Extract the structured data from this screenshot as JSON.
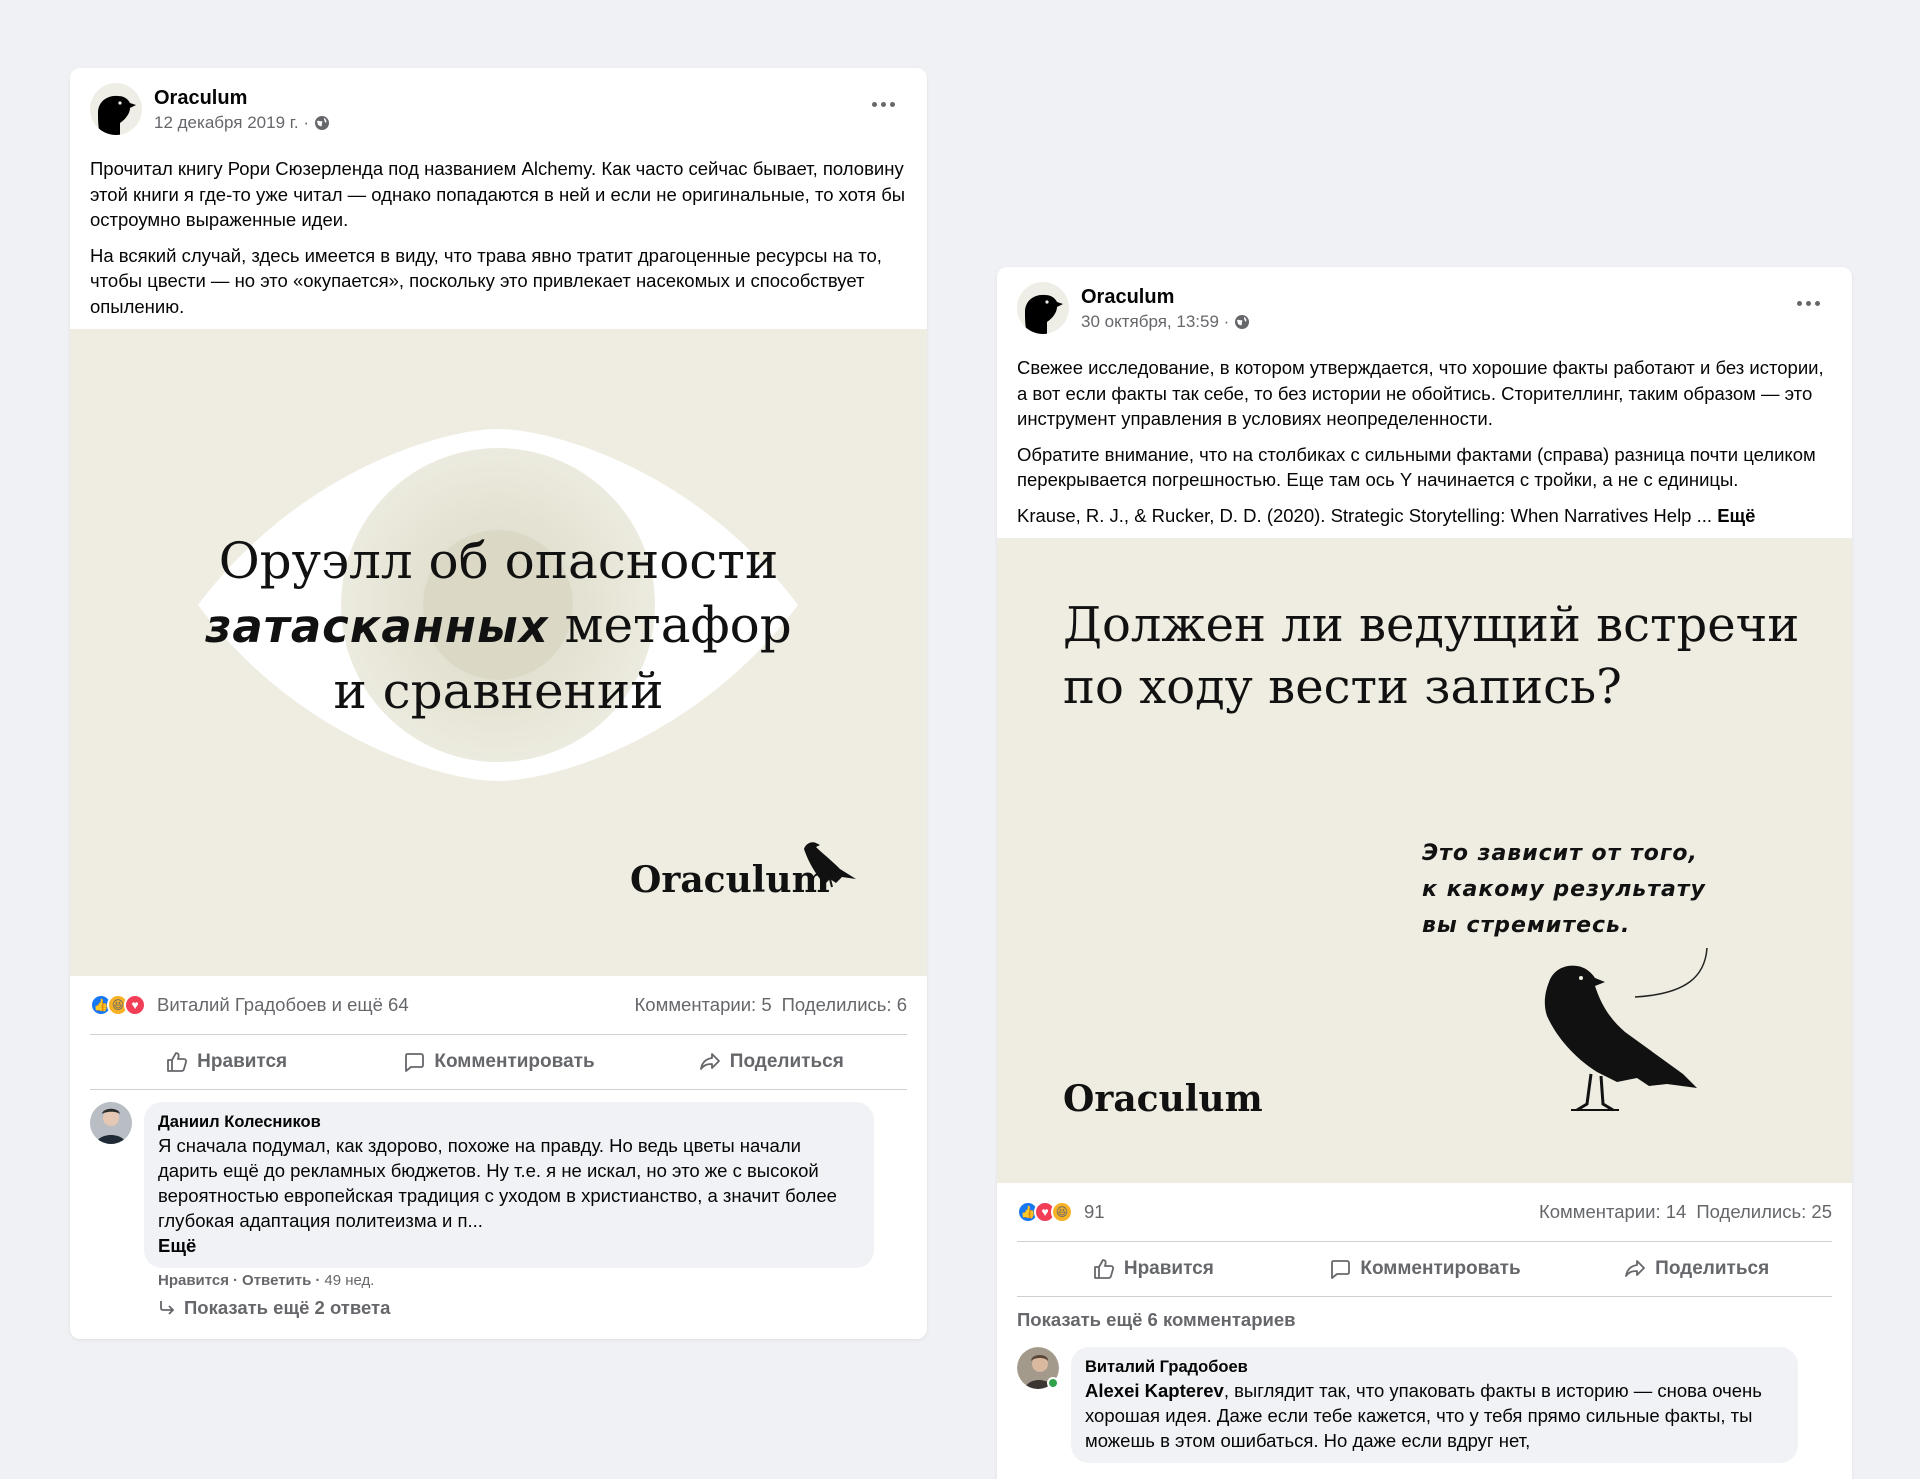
{
  "colors": {
    "background": "#f0f1f4",
    "media_bg": "#efede1",
    "text": "#050505",
    "secondary": "#65676b",
    "like_blue": "#1877f2",
    "love_red": "#f33e58",
    "haha_yellow": "#f7b125"
  },
  "posts": [
    {
      "author": "Oraculum",
      "date": "12 декабря 2019 г. ·",
      "paragraphs": [
        "Прочитал книгу Рори Сюзерленда под названием Alchemy. Как часто сейчас бывает, половину этой книги я где-то уже читал — однако попадаются в ней и если не оригинальные, то хотя бы остроумно выраженные идеи.",
        "На всякий случай, здесь имеется в виду, что трава явно тратит драгоценные ресурсы на то, чтобы цвести — но это «окупается», поскольку это привлекает насекомых и способствует опылению."
      ],
      "image": {
        "line1": "Оруэлл об опасности",
        "line2_bold": "затасканных",
        "line2_rest": " метафор",
        "line3": "и сравнений",
        "brand": "Oraculum"
      },
      "reactions_text": "Виталий Градобоев и ещё 64",
      "comments_count": "Комментарии: 5",
      "shares_count": "Поделились: 6",
      "actions": {
        "like": "Нравится",
        "comment": "Комментировать",
        "share": "Поделиться"
      },
      "comment": {
        "name": "Даниил Колесников",
        "text": "Я сначала подумал, как здорово, похоже на правду. Но ведь цветы начали дарить ещё до рекламных бюджетов. Ну т.е. я не искал, но это же с высокой вероятностью европейская традиция с уходом в христианство, а значит более глубокая адаптация политеизма и п...",
        "see_more": "Ещё",
        "like": "Нравится",
        "reply": "Ответить",
        "time": "49 нед.",
        "show_replies": "Показать ещё 2 ответа"
      }
    },
    {
      "author": "Oraculum",
      "date": "30 октября, 13:59 ·",
      "paragraphs": [
        "Свежее исследование, в котором утверждается, что хорошие факты работают и без истории, а вот если факты так себе, то без истории не обойтись. Сторителлинг, таким образом — это инструмент управления в условиях неопределенности.",
        "Обратите внимание, что на столбиках с сильными фактами (справа) разница почти целиком перекрывается погрешностью. Еще там ось Y начинается с тройки, а не с единицы."
      ],
      "citation": "Krause, R. J., & Rucker, D. D. (2020). Strategic Storytelling: When Narratives Help ...",
      "see_more": "Ещё",
      "image": {
        "title_line1": "Должен ли ведущий встречи",
        "title_line2": "по ходу вести запись?",
        "answer_line1": "Это зависит от того,",
        "answer_line2": "к какому результату",
        "answer_line3": "вы стремитесь.",
        "brand": "Oraculum"
      },
      "reactions_count": "91",
      "comments_count": "Комментарии: 14",
      "shares_count": "Поделились: 25",
      "actions": {
        "like": "Нравится",
        "comment": "Комментировать",
        "share": "Поделиться"
      },
      "show_more_comments": "Показать ещё 6 комментариев",
      "comment": {
        "name": "Виталий Градобоев",
        "mention": "Alexei Kapterev",
        "text": ", выглядит так, что упаковать факты в историю — снова очень хорошая идея. Даже если тебе кажется, что у тебя прямо сильные факты, ты можешь в этом ошибаться. Но даже если вдруг нет,"
      }
    }
  ]
}
